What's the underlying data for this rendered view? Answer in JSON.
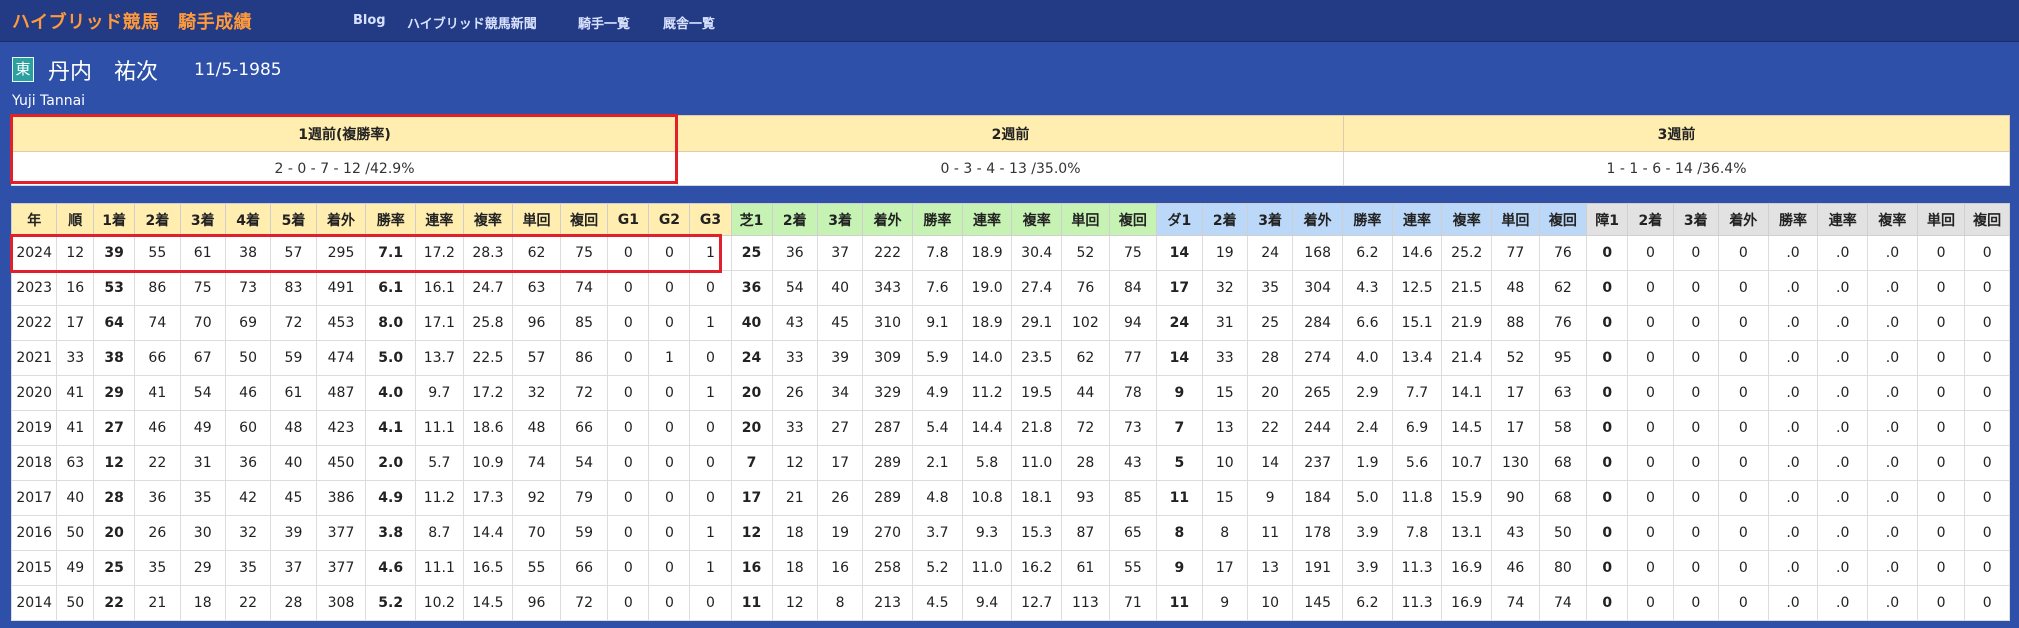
{
  "header": {
    "brand": "ハイブリッド競馬　騎手成績",
    "nav": [
      "Blog",
      "ハイブリッド競馬新聞",
      "騎手一覧",
      "厩舎一覧"
    ]
  },
  "jockey": {
    "region_badge": "東",
    "name": "丹内　祐次",
    "birth": "11/5-1985",
    "name_roman": "Yuji Tannai"
  },
  "recent_weeks": [
    {
      "label": "1週前(複勝率)",
      "value": "2 - 0 - 7 - 12 /42.9%"
    },
    {
      "label": "2週前",
      "value": "0 - 3 - 4 - 13 /35.0%"
    },
    {
      "label": "3週前",
      "value": "1 - 1 - 6 - 14 /36.4%"
    }
  ],
  "stats_table": {
    "headers": [
      "年",
      "順",
      "1着",
      "2着",
      "3着",
      "4着",
      "5着",
      "着外",
      "勝率",
      "連率",
      "複率",
      "単回",
      "複回",
      "G1",
      "G2",
      "G3",
      "芝1",
      "2着",
      "3着",
      "着外",
      "勝率",
      "連率",
      "複率",
      "単回",
      "複回",
      "ダ1",
      "2着",
      "3着",
      "着外",
      "勝率",
      "連率",
      "複率",
      "単回",
      "複回",
      "障1",
      "2着",
      "3着",
      "着外",
      "勝率",
      "連率",
      "複率",
      "単回",
      "複回"
    ],
    "rows": [
      [
        "2024",
        "12",
        "39",
        "55",
        "61",
        "38",
        "57",
        "295",
        "7.1",
        "17.2",
        "28.3",
        "62",
        "75",
        "0",
        "0",
        "1",
        "25",
        "36",
        "37",
        "222",
        "7.8",
        "18.9",
        "30.4",
        "52",
        "75",
        "14",
        "19",
        "24",
        "168",
        "6.2",
        "14.6",
        "25.2",
        "77",
        "76",
        "0",
        "0",
        "0",
        "0",
        ".0",
        ".0",
        ".0",
        "0",
        "0"
      ],
      [
        "2023",
        "16",
        "53",
        "86",
        "75",
        "73",
        "83",
        "491",
        "6.1",
        "16.1",
        "24.7",
        "63",
        "74",
        "0",
        "0",
        "0",
        "36",
        "54",
        "40",
        "343",
        "7.6",
        "19.0",
        "27.4",
        "76",
        "84",
        "17",
        "32",
        "35",
        "304",
        "4.3",
        "12.5",
        "21.5",
        "48",
        "62",
        "0",
        "0",
        "0",
        "0",
        ".0",
        ".0",
        ".0",
        "0",
        "0"
      ],
      [
        "2022",
        "17",
        "64",
        "74",
        "70",
        "69",
        "72",
        "453",
        "8.0",
        "17.1",
        "25.8",
        "96",
        "85",
        "0",
        "0",
        "1",
        "40",
        "43",
        "45",
        "310",
        "9.1",
        "18.9",
        "29.1",
        "102",
        "94",
        "24",
        "31",
        "25",
        "284",
        "6.6",
        "15.1",
        "21.9",
        "88",
        "76",
        "0",
        "0",
        "0",
        "0",
        ".0",
        ".0",
        ".0",
        "0",
        "0"
      ],
      [
        "2021",
        "33",
        "38",
        "66",
        "67",
        "50",
        "59",
        "474",
        "5.0",
        "13.7",
        "22.5",
        "57",
        "86",
        "0",
        "1",
        "0",
        "24",
        "33",
        "39",
        "309",
        "5.9",
        "14.0",
        "23.5",
        "62",
        "77",
        "14",
        "33",
        "28",
        "274",
        "4.0",
        "13.4",
        "21.4",
        "52",
        "95",
        "0",
        "0",
        "0",
        "0",
        ".0",
        ".0",
        ".0",
        "0",
        "0"
      ],
      [
        "2020",
        "41",
        "29",
        "41",
        "54",
        "46",
        "61",
        "487",
        "4.0",
        "9.7",
        "17.2",
        "32",
        "72",
        "0",
        "0",
        "1",
        "20",
        "26",
        "34",
        "329",
        "4.9",
        "11.2",
        "19.5",
        "44",
        "78",
        "9",
        "15",
        "20",
        "265",
        "2.9",
        "7.7",
        "14.1",
        "17",
        "63",
        "0",
        "0",
        "0",
        "0",
        ".0",
        ".0",
        ".0",
        "0",
        "0"
      ],
      [
        "2019",
        "41",
        "27",
        "46",
        "49",
        "60",
        "48",
        "423",
        "4.1",
        "11.1",
        "18.6",
        "48",
        "66",
        "0",
        "0",
        "0",
        "20",
        "33",
        "27",
        "287",
        "5.4",
        "14.4",
        "21.8",
        "72",
        "73",
        "7",
        "13",
        "22",
        "244",
        "2.4",
        "6.9",
        "14.5",
        "17",
        "58",
        "0",
        "0",
        "0",
        "0",
        ".0",
        ".0",
        ".0",
        "0",
        "0"
      ],
      [
        "2018",
        "63",
        "12",
        "22",
        "31",
        "36",
        "40",
        "450",
        "2.0",
        "5.7",
        "10.9",
        "74",
        "54",
        "0",
        "0",
        "0",
        "7",
        "12",
        "17",
        "289",
        "2.1",
        "5.8",
        "11.0",
        "28",
        "43",
        "5",
        "10",
        "14",
        "237",
        "1.9",
        "5.6",
        "10.7",
        "130",
        "68",
        "0",
        "0",
        "0",
        "0",
        ".0",
        ".0",
        ".0",
        "0",
        "0"
      ],
      [
        "2017",
        "40",
        "28",
        "36",
        "35",
        "42",
        "45",
        "386",
        "4.9",
        "11.2",
        "17.3",
        "92",
        "79",
        "0",
        "0",
        "0",
        "17",
        "21",
        "26",
        "289",
        "4.8",
        "10.8",
        "18.1",
        "93",
        "85",
        "11",
        "15",
        "9",
        "184",
        "5.0",
        "11.8",
        "15.9",
        "90",
        "68",
        "0",
        "0",
        "0",
        "0",
        ".0",
        ".0",
        ".0",
        "0",
        "0"
      ],
      [
        "2016",
        "50",
        "20",
        "26",
        "30",
        "32",
        "39",
        "377",
        "3.8",
        "8.7",
        "14.4",
        "70",
        "59",
        "0",
        "0",
        "1",
        "12",
        "18",
        "19",
        "270",
        "3.7",
        "9.3",
        "15.3",
        "87",
        "65",
        "8",
        "8",
        "11",
        "178",
        "3.9",
        "7.8",
        "13.1",
        "43",
        "50",
        "0",
        "0",
        "0",
        "0",
        ".0",
        ".0",
        ".0",
        "0",
        "0"
      ],
      [
        "2015",
        "49",
        "25",
        "35",
        "29",
        "35",
        "37",
        "377",
        "4.6",
        "11.1",
        "16.5",
        "55",
        "66",
        "0",
        "0",
        "1",
        "16",
        "18",
        "16",
        "258",
        "5.2",
        "11.0",
        "16.2",
        "61",
        "55",
        "9",
        "17",
        "13",
        "191",
        "3.9",
        "11.3",
        "16.9",
        "46",
        "80",
        "0",
        "0",
        "0",
        "0",
        ".0",
        ".0",
        ".0",
        "0",
        "0"
      ],
      [
        "2014",
        "50",
        "22",
        "21",
        "18",
        "22",
        "28",
        "308",
        "5.2",
        "10.2",
        "14.5",
        "96",
        "72",
        "0",
        "0",
        "0",
        "11",
        "12",
        "8",
        "213",
        "4.5",
        "9.4",
        "12.7",
        "113",
        "71",
        "11",
        "9",
        "10",
        "145",
        "6.2",
        "11.3",
        "16.9",
        "74",
        "74",
        "0",
        "0",
        "0",
        "0",
        ".0",
        ".0",
        ".0",
        "0",
        "0"
      ]
    ]
  },
  "colors": {
    "page_bg": "#2e50a8",
    "nav_bg": "#233a84",
    "brand": "#ff9a3c",
    "header_yellow": "#ffeeb0",
    "header_green": "#c6f3b3",
    "header_blue": "#bcd8f8",
    "header_gray": "#e2e2e2",
    "highlight_red": "#e0202a"
  }
}
